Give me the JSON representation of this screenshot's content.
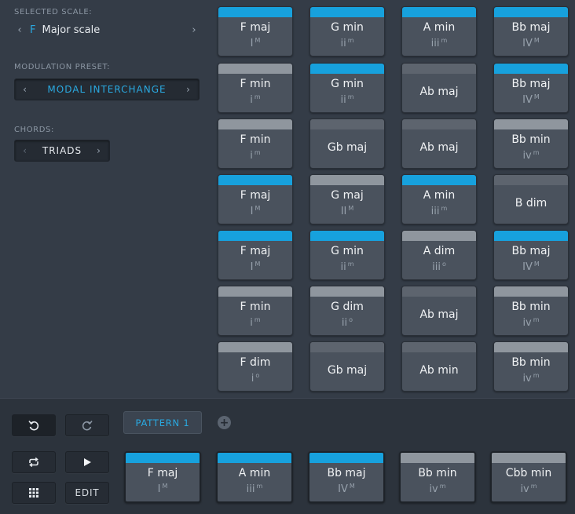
{
  "selected_scale": {
    "label": "SELECTED SCALE:",
    "key": "F",
    "name": "Major scale"
  },
  "modulation": {
    "label": "MODULATION PRESET:",
    "value": "MODAL INTERCHANGE"
  },
  "chords_setting": {
    "label": "CHORDS:",
    "value": "TRIADS"
  },
  "icons": {
    "prev": "‹",
    "next": "›",
    "undo": "undo-icon",
    "redo": "redo-icon",
    "loop": "loop-icon",
    "play": "play-icon",
    "grid": "grid-icon",
    "add": "plus-icon"
  },
  "colors": {
    "accent": "#17a1dd",
    "pad": "#4a525d",
    "bar_inactive": "#8f969e",
    "background": "#343c47"
  },
  "grid": [
    [
      {
        "name": "F maj",
        "deg": "I",
        "q": "M",
        "state": "on"
      },
      {
        "name": "G min",
        "deg": "ii",
        "q": "m",
        "state": "on"
      },
      {
        "name": "A min",
        "deg": "iii",
        "q": "m",
        "state": "on"
      },
      {
        "name": "Bb maj",
        "deg": "IV",
        "q": "M",
        "state": "on"
      }
    ],
    [
      {
        "name": "F min",
        "deg": "i",
        "q": "m",
        "state": "off"
      },
      {
        "name": "G min",
        "deg": "ii",
        "q": "m",
        "state": "on"
      },
      {
        "name": "Ab maj",
        "deg": "",
        "q": "",
        "state": "dim"
      },
      {
        "name": "Bb maj",
        "deg": "IV",
        "q": "M",
        "state": "on"
      }
    ],
    [
      {
        "name": "F min",
        "deg": "i",
        "q": "m",
        "state": "off"
      },
      {
        "name": "Gb maj",
        "deg": "",
        "q": "",
        "state": "dim"
      },
      {
        "name": "Ab maj",
        "deg": "",
        "q": "",
        "state": "dim"
      },
      {
        "name": "Bb min",
        "deg": "iv",
        "q": "m",
        "state": "off"
      }
    ],
    [
      {
        "name": "F maj",
        "deg": "I",
        "q": "M",
        "state": "on"
      },
      {
        "name": "G maj",
        "deg": "II",
        "q": "M",
        "state": "off"
      },
      {
        "name": "A min",
        "deg": "iii",
        "q": "m",
        "state": "on"
      },
      {
        "name": "B dim",
        "deg": "",
        "q": "",
        "state": "dim"
      }
    ],
    [
      {
        "name": "F maj",
        "deg": "I",
        "q": "M",
        "state": "on"
      },
      {
        "name": "G min",
        "deg": "ii",
        "q": "m",
        "state": "on"
      },
      {
        "name": "A dim",
        "deg": "iii",
        "q": "o",
        "state": "off"
      },
      {
        "name": "Bb maj",
        "deg": "IV",
        "q": "M",
        "state": "on"
      }
    ],
    [
      {
        "name": "F min",
        "deg": "i",
        "q": "m",
        "state": "off"
      },
      {
        "name": "G dim",
        "deg": "ii",
        "q": "o",
        "state": "off"
      },
      {
        "name": "Ab maj",
        "deg": "",
        "q": "",
        "state": "dim"
      },
      {
        "name": "Bb min",
        "deg": "iv",
        "q": "m",
        "state": "off"
      }
    ],
    [
      {
        "name": "F dim",
        "deg": "i",
        "q": "o",
        "state": "off"
      },
      {
        "name": "Gb maj",
        "deg": "",
        "q": "",
        "state": "dim"
      },
      {
        "name": "Ab min",
        "deg": "",
        "q": "",
        "state": "dim"
      },
      {
        "name": "Bb min",
        "deg": "iv",
        "q": "m",
        "state": "off"
      }
    ]
  ],
  "transport": {
    "edit_label": "EDIT",
    "pattern_label": "PATTERN 1"
  },
  "sequence": [
    {
      "name": "F maj",
      "deg": "I",
      "q": "M",
      "state": "on"
    },
    {
      "name": "A min",
      "deg": "iii",
      "q": "m",
      "state": "on"
    },
    {
      "name": "Bb maj",
      "deg": "IV",
      "q": "M",
      "state": "on"
    },
    {
      "name": "Bb min",
      "deg": "iv",
      "q": "m",
      "state": "off"
    },
    {
      "name": "Cbb min",
      "deg": "iv",
      "q": "m",
      "state": "off"
    }
  ]
}
